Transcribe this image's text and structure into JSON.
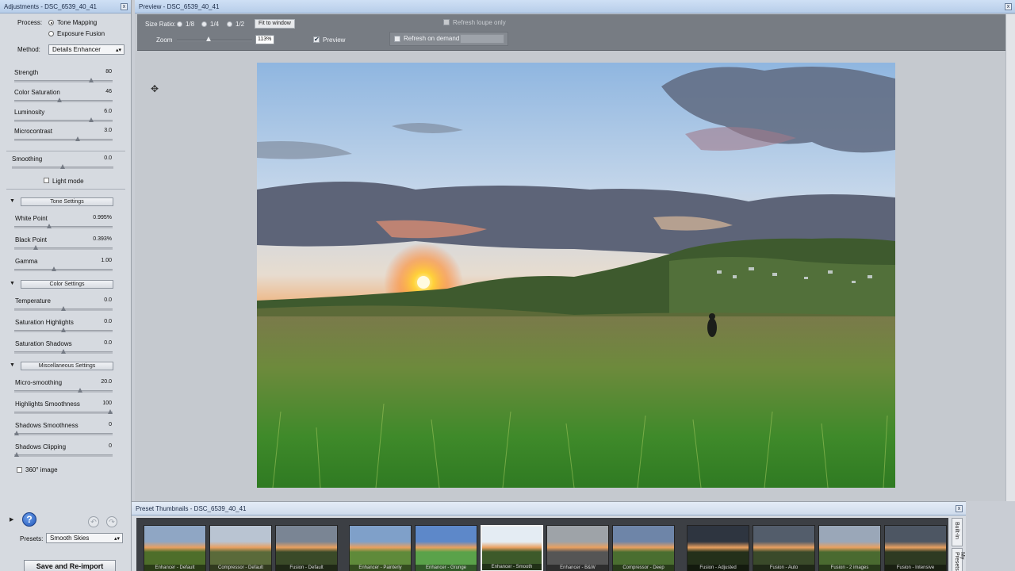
{
  "adjustments": {
    "title": "Adjustments - DSC_6539_40_41",
    "close": "x",
    "process_label": "Process:",
    "process_options": [
      "Tone Mapping",
      "Exposure Fusion"
    ],
    "method_label": "Method:",
    "method_value": "Details Enhancer",
    "sliders": [
      {
        "label": "Strength",
        "value": "80",
        "level": 0.8
      },
      {
        "label": "Color Saturation",
        "value": "46",
        "level": 0.46
      },
      {
        "label": "Luminosity",
        "value": "6.0",
        "level": 0.8
      },
      {
        "label": "Microcontrast",
        "value": "3.0",
        "level": 0.65
      }
    ],
    "smoothing": {
      "label": "Smoothing",
      "value": "0.0",
      "level": 0.5
    },
    "light_mode": "Light mode",
    "tone_settings": {
      "title": "Tone Settings",
      "sliders": [
        {
          "label": "White Point",
          "value": "0.995%",
          "level": 0.35
        },
        {
          "label": "Black Point",
          "value": "0.393%",
          "level": 0.2
        },
        {
          "label": "Gamma",
          "value": "1.00",
          "level": 0.4
        }
      ]
    },
    "color_settings": {
      "title": "Color Settings",
      "sliders": [
        {
          "label": "Temperature",
          "value": "0.0",
          "level": 0.5
        },
        {
          "label": "Saturation Highlights",
          "value": "0.0",
          "level": 0.5
        },
        {
          "label": "Saturation Shadows",
          "value": "0.0",
          "level": 0.5
        }
      ]
    },
    "misc_settings": {
      "title": "Miscellaneous Settings",
      "sliders": [
        {
          "label": "Micro-smoothing",
          "value": "20.0",
          "level": 0.68
        },
        {
          "label": "Highlights Smoothness",
          "value": "100",
          "level": 1.0
        },
        {
          "label": "Shadows Smoothness",
          "value": "0",
          "level": 0.0
        },
        {
          "label": "Shadows Clipping",
          "value": "0",
          "level": 0.0
        }
      ]
    },
    "image_360": "360° image",
    "help": "?",
    "presets_label": "Presets:",
    "presets_value": "Smooth Skies",
    "save_button": "Save and Re-import"
  },
  "preview": {
    "title": "Preview - DSC_6539_40_41",
    "size_ratio_label": "Size Ratio:",
    "size_ratio_options": [
      "1/8",
      "1/4",
      "1/2"
    ],
    "fit_button": "Fit to window",
    "zoom_label": "Zoom",
    "zoom_value": "113%",
    "preview_check": "Preview",
    "refresh_loupe": "Refresh loupe only",
    "refresh_demand": "Refresh on demand:"
  },
  "preset_thumbnails": {
    "title": "Preset Thumbnails - DSC_6539_40_41",
    "items": [
      "Enhancer - Default",
      "Compressor - Default",
      "Fusion - Default",
      "Enhancer - Painterly",
      "Enhancer - Grunge",
      "Enhancer - Smooth",
      "Enhancer - B&W",
      "Compressor - Deep",
      "Fusion - Adjusted",
      "Fusion - Auto",
      "Fusion - 2 images",
      "Fusion - Intensive"
    ],
    "tabs": [
      "Built-In",
      "My Presets"
    ]
  }
}
